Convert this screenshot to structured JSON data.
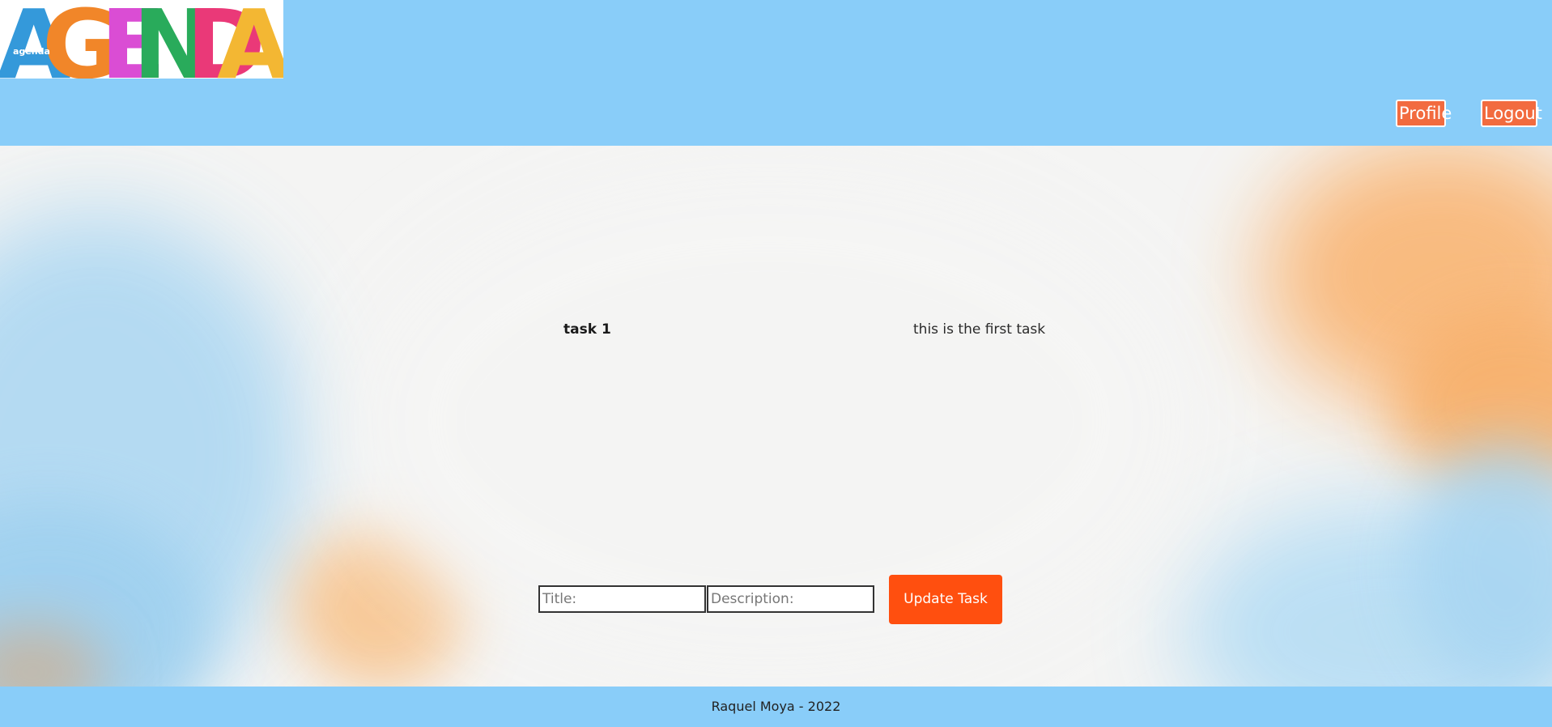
{
  "header": {
    "logo": {
      "letters": [
        "A",
        "G",
        "E",
        "N",
        "D",
        "A"
      ],
      "small_text": "agenda",
      "letter_colors": [
        "#1f8fd6",
        "#f07a12",
        "#d63ad0",
        "#12a34a",
        "#e8246a",
        "#f2b01e"
      ]
    },
    "nav": {
      "profile_label": "Profile",
      "logout_label": "Logout"
    }
  },
  "main": {
    "task": {
      "title": "task 1",
      "description": "this is the first task"
    },
    "form": {
      "title_placeholder": "Title:",
      "description_placeholder": "Description:",
      "update_label": "Update Task"
    }
  },
  "footer": {
    "text": "Raquel Moya - 2022"
  },
  "colors": {
    "header_bg": "#89cdf9",
    "nav_button": "#f26b3f",
    "accent": "#ff4f0f"
  }
}
